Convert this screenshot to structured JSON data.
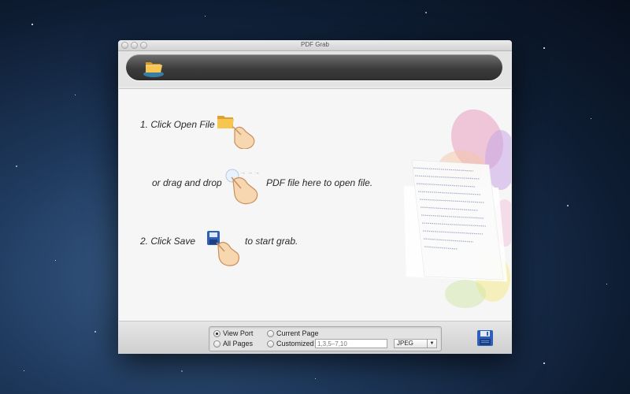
{
  "window": {
    "title": "PDF Grab"
  },
  "toolbar": {
    "open_icon": "folder-icon"
  },
  "instructions": {
    "step1_prefix": "1. Click  Open File",
    "drag_prefix": "or drag and drop",
    "drag_suffix": "PDF file here to open file.",
    "step2_prefix": "2. Click Save",
    "step2_suffix": "to start grab."
  },
  "options": {
    "view_port_label": "View Port",
    "all_pages_label": "All Pages",
    "current_page_label": "Current Page",
    "customized_label": "Customized",
    "customized_value": "1,3,5–7,10",
    "format_value": "JPEG",
    "selected": "View Port"
  },
  "colors": {
    "accent_blue": "#2f5fb8",
    "folder_yellow": "#f2b63c",
    "toolbar_dark": "#3c3c3c"
  }
}
